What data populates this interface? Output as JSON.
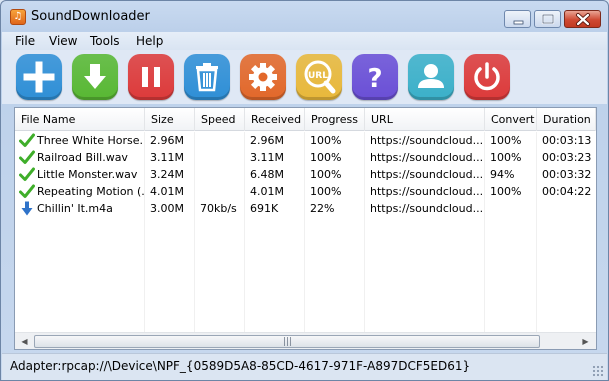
{
  "window": {
    "title": "SoundDownloader",
    "app_icon_glyph": "♫",
    "minimize_icon": "minimize-icon",
    "maximize_icon": "maximize-icon",
    "close_icon": "close-icon"
  },
  "menu": {
    "items": [
      {
        "label": "File"
      },
      {
        "label": "View"
      },
      {
        "label": "Tools"
      },
      {
        "label": "Help"
      }
    ]
  },
  "toolbar": {
    "buttons": [
      {
        "name": "add",
        "icon": "plus-icon",
        "color": "#2f8fd6"
      },
      {
        "name": "download",
        "icon": "download-arrow-icon",
        "color": "#58b833"
      },
      {
        "name": "pause",
        "icon": "pause-icon",
        "color": "#dd3a3a"
      },
      {
        "name": "delete",
        "icon": "trash-icon",
        "color": "#2f8fd6"
      },
      {
        "name": "settings",
        "icon": "gear-icon",
        "color": "#e2682a"
      },
      {
        "name": "url",
        "icon": "url-search-icon",
        "color": "#e8b83a",
        "text": "URL"
      },
      {
        "name": "help",
        "icon": "question-icon",
        "color": "#6a4fd6",
        "text": "?"
      },
      {
        "name": "account",
        "icon": "user-icon",
        "color": "#3bb0c9"
      },
      {
        "name": "exit",
        "icon": "power-icon",
        "color": "#dd3a3a"
      }
    ]
  },
  "table": {
    "columns": [
      "File Name",
      "Size",
      "Speed",
      "Received",
      "Progress",
      "URL",
      "Convert",
      "Duration"
    ],
    "rows": [
      {
        "status": "done",
        "name": "Three White Horse...",
        "size": "2.96M",
        "speed": "",
        "received": "2.96M",
        "progress": "100%",
        "url": "https://soundcloud....",
        "convert": "100%",
        "duration": "00:03:13"
      },
      {
        "status": "done",
        "name": "Railroad Bill.wav",
        "size": "3.11M",
        "speed": "",
        "received": "3.11M",
        "progress": "100%",
        "url": "https://soundcloud....",
        "convert": "100%",
        "duration": "00:03:23"
      },
      {
        "status": "done",
        "name": "Little Monster.wav",
        "size": "3.24M",
        "speed": "",
        "received": "6.48M",
        "progress": "100%",
        "url": "https://soundcloud....",
        "convert": "94%",
        "duration": "00:03:32"
      },
      {
        "status": "done",
        "name": "Repeating Motion (...",
        "size": "4.01M",
        "speed": "",
        "received": "4.01M",
        "progress": "100%",
        "url": "https://soundcloud....",
        "convert": "100%",
        "duration": "00:04:22"
      },
      {
        "status": "downloading",
        "name": "Chillin' It.m4a",
        "size": "3.00M",
        "speed": "70kb/s",
        "received": "691K",
        "progress": "22%",
        "url": "https://soundcloud....",
        "convert": "",
        "duration": ""
      }
    ]
  },
  "scrollbar": {
    "left_arrow": "◀",
    "right_arrow": "▶",
    "grip": "|||"
  },
  "status": {
    "text": "Adapter:rpcap://\\Device\\NPF_{0589D5A8-85CD-4617-971F-A897DCF5ED61}"
  },
  "colors": {
    "done_check": "#3fae2a",
    "downloading_arrow": "#2f73c9"
  }
}
